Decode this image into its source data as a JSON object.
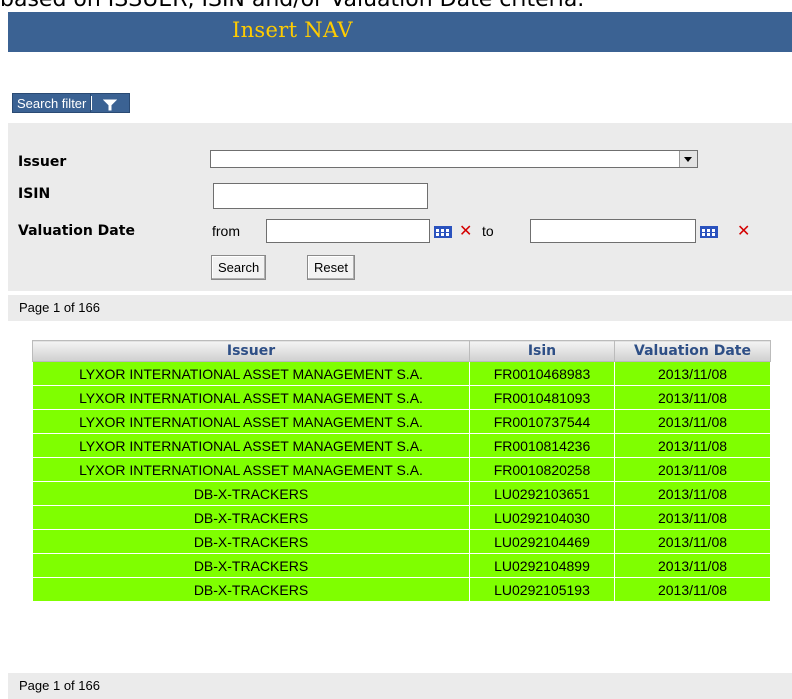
{
  "header": {
    "cut_text": "based on ISSUER, ISIN and/or Valuation Date criteria.",
    "title": "Insert NAV"
  },
  "filter": {
    "toggle_label": "Search filter",
    "issuer_label": "Issuer",
    "issuer_value": "",
    "isin_label": "ISIN",
    "isin_value": "",
    "valuation_label": "Valuation Date",
    "from_label": "from",
    "from_value": "",
    "to_label": "to",
    "to_value": "",
    "search_button": "Search",
    "reset_button": "Reset"
  },
  "pager": {
    "top": "Page 1 of 166",
    "bottom": "Page 1 of 166"
  },
  "table": {
    "headers": [
      "Issuer",
      "Isin",
      "Valuation Date"
    ],
    "rows": [
      [
        "LYXOR INTERNATIONAL ASSET MANAGEMENT S.A.",
        "FR0010468983",
        "2013/11/08"
      ],
      [
        "LYXOR INTERNATIONAL ASSET MANAGEMENT S.A.",
        "FR0010481093",
        "2013/11/08"
      ],
      [
        "LYXOR INTERNATIONAL ASSET MANAGEMENT S.A.",
        "FR0010737544",
        "2013/11/08"
      ],
      [
        "LYXOR INTERNATIONAL ASSET MANAGEMENT S.A.",
        "FR0010814236",
        "2013/11/08"
      ],
      [
        "LYXOR INTERNATIONAL ASSET MANAGEMENT S.A.",
        "FR0010820258",
        "2013/11/08"
      ],
      [
        "DB-X-TRACKERS",
        "LU0292103651",
        "2013/11/08"
      ],
      [
        "DB-X-TRACKERS",
        "LU0292104030",
        "2013/11/08"
      ],
      [
        "DB-X-TRACKERS",
        "LU0292104469",
        "2013/11/08"
      ],
      [
        "DB-X-TRACKERS",
        "LU0292104899",
        "2013/11/08"
      ],
      [
        "DB-X-TRACKERS",
        "LU0292105193",
        "2013/11/08"
      ]
    ]
  },
  "colors": {
    "title_bar": "#3b6293",
    "title_text": "#ffcc00",
    "row_bg": "#7fff00",
    "header_text": "#2e4f86"
  },
  "icons": [
    "filter-icon",
    "calendar-icon",
    "clear-icon",
    "dropdown-arrow-icon"
  ]
}
